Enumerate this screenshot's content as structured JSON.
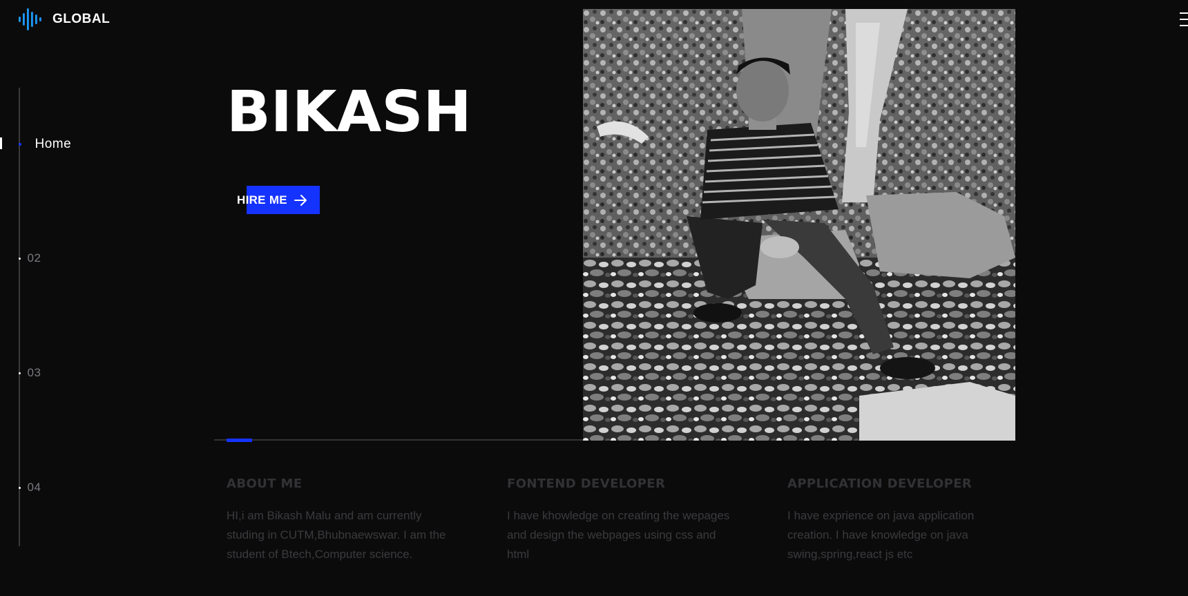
{
  "header": {
    "logo_text": "GLOBAL",
    "logo_icon": "soundwave-icon",
    "menu_icon": "hamburger-menu-icon"
  },
  "sidebar": {
    "items": [
      {
        "label": "Home",
        "active": true
      },
      {
        "label": "02",
        "active": false
      },
      {
        "label": "03",
        "active": false
      },
      {
        "label": "04",
        "active": false
      }
    ]
  },
  "hero": {
    "title": "BIKASH",
    "button_label": "HIRE ME",
    "button_icon": "arrow-right-icon",
    "slide_progress": 0.07
  },
  "sections": [
    {
      "title": "ABOUT ME",
      "text": "HI,i am Bikash Malu and am currently studing in CUTM,Bhubnaewswar. I am the student of Btech,Computer science."
    },
    {
      "title": "FONTEND DEVELOPER",
      "text": "I have khowledge on creating the wepages and design the webpages using css and html"
    },
    {
      "title": "APPLICATION DEVELOPER",
      "text": "I have exprience on java application creation. I have knowledge on java swing,spring,react js etc"
    }
  ],
  "colors": {
    "background": "#0b0b0c",
    "accent": "#1533ff",
    "text": "#ffffff"
  }
}
